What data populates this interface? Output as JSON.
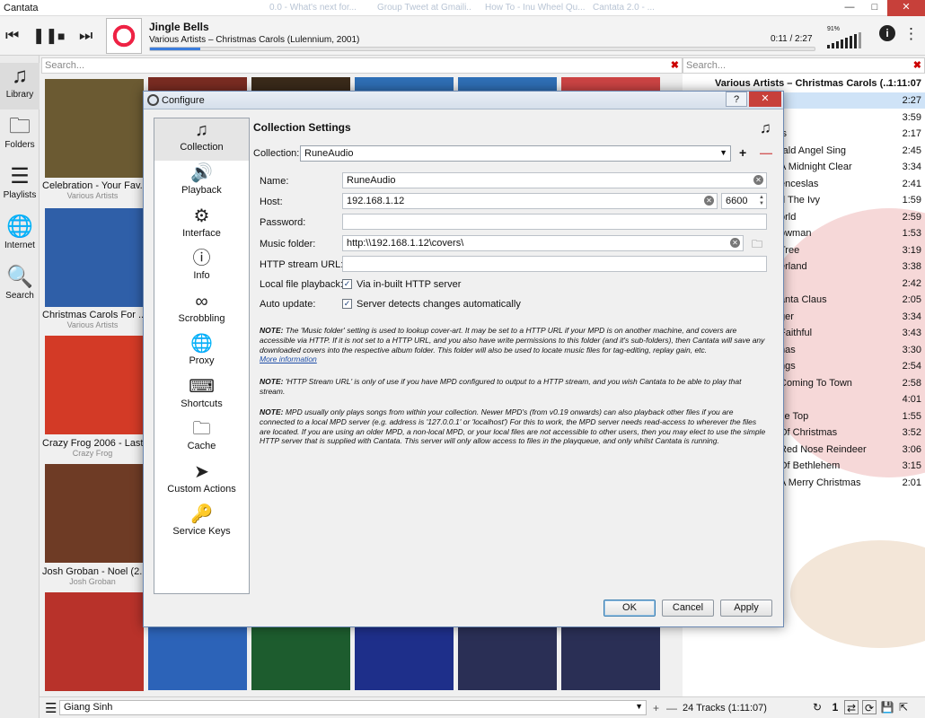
{
  "window": {
    "title": "Cantata",
    "ghost_tabs": [
      "0.0 - What's next for...",
      "Group Tweet at Gmaili..",
      "How To - Inu Wheel Qu...",
      "Cantata 2.0 - ..."
    ]
  },
  "player": {
    "prev_icon": "previous-icon",
    "pause_icon": "pause-icon",
    "stop_icon": "stop-icon",
    "next_icon": "next-icon",
    "track_title": "Jingle Bells",
    "track_artist": "Various Artists – Christmas Carols (Lulennium, 2001)",
    "elapsed": "0:11 / 2:27",
    "progress": 0.075,
    "volume_percent": "91%"
  },
  "sidebar": {
    "items": [
      {
        "label": "Library",
        "icon": "music-note-icon"
      },
      {
        "label": "Folders",
        "icon": "folder-icon"
      },
      {
        "label": "Playlists",
        "icon": "list-icon"
      },
      {
        "label": "Internet",
        "icon": "globe-icon"
      },
      {
        "label": "Search",
        "icon": "search-icon"
      }
    ]
  },
  "library": {
    "search_placeholder": "Search...",
    "albums": [
      {
        "title": "Celebration - Your Fav...",
        "artist": "Various Artists",
        "color": "#6b5a32"
      },
      {
        "title": "Christmas Carols For ...",
        "artist": "Various Artists",
        "color": "#2f5fa8"
      },
      {
        "title": "Crazy Frog 2006 - Last...",
        "artist": "Crazy Frog",
        "color": "#d33a26"
      },
      {
        "title": "Josh Groban - Noel (2...",
        "artist": "Josh Groban",
        "color": "#6e3b25"
      },
      {
        "title": "",
        "artist": "",
        "color": "#b8322a"
      }
    ]
  },
  "playqueue": {
    "search_placeholder": "Search...",
    "header_title": "Various Artists – Christmas Carols (...",
    "header_duration": "1:11:07",
    "rows": [
      {
        "name": "",
        "duration": "2:27"
      },
      {
        "name": "",
        "duration": "3:59"
      },
      {
        "name": "ls",
        "duration": "2:17"
      },
      {
        "name": "rald Angel Sing",
        "duration": "2:45"
      },
      {
        "name": "A Midnight Clear",
        "duration": "3:34"
      },
      {
        "name": "enceslas",
        "duration": "2:41"
      },
      {
        "name": "d The Ivy",
        "duration": "1:59"
      },
      {
        "name": "orld",
        "duration": "2:59"
      },
      {
        "name": "owman",
        "duration": "1:53"
      },
      {
        "name": "Tree",
        "duration": "3:19"
      },
      {
        "name": "erland",
        "duration": "3:38"
      },
      {
        "name": "",
        "duration": "2:42"
      },
      {
        "name": "anta Claus",
        "duration": "2:05"
      },
      {
        "name": "ger",
        "duration": "3:34"
      },
      {
        "name": "Faithful",
        "duration": "3:43"
      },
      {
        "name": "nas",
        "duration": "3:30"
      },
      {
        "name": "ngs",
        "duration": "2:54"
      },
      {
        "name": "Coming To Town",
        "duration": "2:58"
      },
      {
        "name": "l",
        "duration": "4:01"
      },
      {
        "name": "se Top",
        "duration": "1:55"
      },
      {
        "name": "Of Christmas",
        "duration": "3:52"
      },
      {
        "name": "Red Nose Reindeer",
        "duration": "3:06"
      },
      {
        "name": "Of Bethlehem",
        "duration": "3:15"
      },
      {
        "name": "A Merry Christmas",
        "duration": "2:01"
      }
    ]
  },
  "bottom": {
    "playlist_name": "Giang Sinh",
    "tracks_summary": "24 Tracks (1:11:07)"
  },
  "dialog": {
    "title": "Configure",
    "nav": [
      {
        "label": "Collection",
        "icon": "music-note-icon"
      },
      {
        "label": "Playback",
        "icon": "speaker-icon"
      },
      {
        "label": "Interface",
        "icon": "sliders-icon"
      },
      {
        "label": "Info",
        "icon": "info-icon"
      },
      {
        "label": "Scrobbling",
        "icon": "lastfm-icon"
      },
      {
        "label": "Proxy",
        "icon": "globe-icon"
      },
      {
        "label": "Shortcuts",
        "icon": "keyboard-icon"
      },
      {
        "label": "Cache",
        "icon": "folder-icon"
      },
      {
        "label": "Custom Actions",
        "icon": "rocket-icon"
      },
      {
        "label": "Service Keys",
        "icon": "key-icon"
      }
    ],
    "panel_title": "Collection Settings",
    "collection_label": "Collection:",
    "collection_value": "RuneAudio",
    "name_label": "Name:",
    "name_value": "RuneAudio",
    "host_label": "Host:",
    "host_value": "192.168.1.12",
    "port_value": "6600",
    "password_label": "Password:",
    "password_value": "",
    "music_folder_label": "Music folder:",
    "music_folder_value": "http:\\\\192.168.1.12\\covers\\",
    "stream_label": "HTTP stream URL:",
    "stream_value": "",
    "local_label": "Local file playback:",
    "local_check_label": "Via in-built HTTP server",
    "local_checked": true,
    "autoupdate_label": "Auto update:",
    "autoupdate_check_label": "Server detects changes automatically",
    "autoupdate_checked": true,
    "note1_prefix": "NOTE:",
    "note1_text": " The 'Music folder' setting is used to lookup cover-art. It may be set to a HTTP URL if your MPD is on another machine, and covers are accessible via HTTP. If it is not set to a HTTP URL, and you also have write permissions to this folder (and it's sub-folders), then Cantata will save any downloaded covers into the respective album folder. This folder will also be used to locate music files for tag-editing, replay gain, etc.",
    "note1_link": "More information",
    "note2_prefix": "NOTE:",
    "note2_text": " 'HTTP Stream URL' is only of use if you have MPD configured to output to a HTTP stream, and you wish Cantata to be able to play that stream.",
    "note3_prefix": "NOTE:",
    "note3_text": " MPD usually only plays songs from within your collection. Newer MPD's (from v0.19 onwards) can also playback other files if you are connected to a local MPD server (e.g. address is '127.0.0.1' or 'localhost') For this to work, the MPD server needs read-access to wherever the files are located. If you are using an older MPD, a non-local MPD, or your local files are not accessible to other users, then you may elect to use the simple HTTP server that is supplied with Cantata. This server will only allow access to files in the playqueue, and only whilst Cantata is running.",
    "buttons": {
      "ok": "OK",
      "cancel": "Cancel",
      "apply": "Apply"
    }
  }
}
